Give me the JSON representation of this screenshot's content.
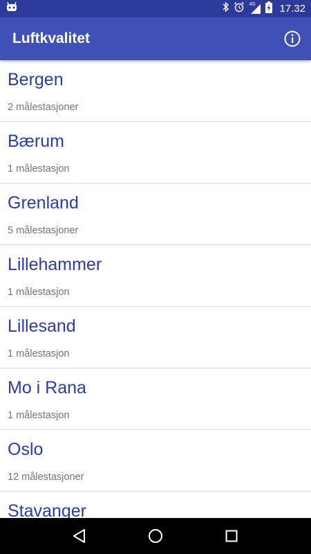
{
  "status_bar": {
    "time": "17.32",
    "network_label": "4G",
    "icons": [
      "android-debug-icon",
      "bluetooth-icon",
      "alarm-icon",
      "signal-icon",
      "battery-charging-icon"
    ]
  },
  "app_bar": {
    "title": "Luftkvalitet",
    "info_icon": "info-icon"
  },
  "colors": {
    "status_bar": "#2c3a9c",
    "app_bar": "#3f51b5",
    "item_title": "#2a3bb0",
    "item_subtitle": "#757575"
  },
  "list": {
    "items": [
      {
        "city": "Bergen",
        "stations": "2 målestasjoner"
      },
      {
        "city": "Bærum",
        "stations": "1 målestasjon"
      },
      {
        "city": "Grenland",
        "stations": "5 målestasjoner"
      },
      {
        "city": "Lillehammer",
        "stations": "1 målestasjon"
      },
      {
        "city": "Lillesand",
        "stations": "1 målestasjon"
      },
      {
        "city": "Mo i Rana",
        "stations": "1 målestasjon"
      },
      {
        "city": "Oslo",
        "stations": "12 målestasjoner"
      },
      {
        "city": "Stavanger",
        "stations": ""
      }
    ]
  },
  "nav_bar": {
    "icons": [
      "back-icon",
      "home-icon",
      "recents-icon"
    ]
  }
}
